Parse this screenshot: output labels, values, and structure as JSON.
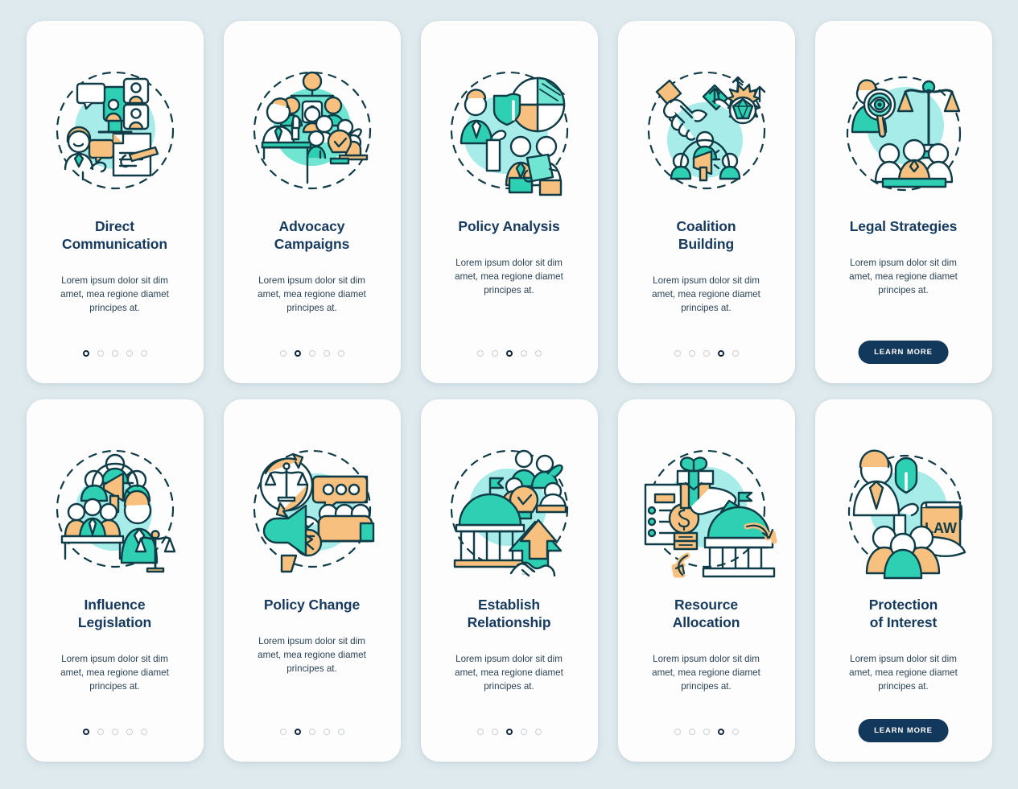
{
  "page": {
    "background_color": "#dfeaee",
    "card_background": "#fdfdfd",
    "title_color": "#163a5f",
    "body_color": "#2b4256",
    "accent_teal": "#2ecfb3",
    "accent_mint": "#a8ecea",
    "accent_orange": "#f8c07e",
    "outline_color": "#0f3c47",
    "button_color": "#12385c",
    "dot_inactive_color": "#c9ced3",
    "dot_active_color": "#10263d"
  },
  "body_text": "Lorem ipsum dolor sit dim\namet, mea regione diamet\nprincipes at.",
  "learn_more_label": "LEARN MORE",
  "dots_total": 5,
  "cards": [
    {
      "id": "direct-communication",
      "title": "Direct\nCommunication",
      "illustration": "direct-communication-illustration",
      "body": "Lorem ipsum dolor sit dim\namet, mea regione diamet\nprincipes at.",
      "footer": "dots",
      "active_dot": 1
    },
    {
      "id": "advocacy-campaigns",
      "title": "Advocacy\nCampaigns",
      "illustration": "advocacy-campaigns-illustration",
      "body": "Lorem ipsum dolor sit dim\namet, mea regione diamet\nprincipes at.",
      "footer": "dots",
      "active_dot": 2
    },
    {
      "id": "policy-analysis",
      "title": "Policy Analysis",
      "illustration": "policy-analysis-illustration",
      "body": "Lorem ipsum dolor sit dim\namet, mea regione diamet\nprincipes at.",
      "footer": "dots",
      "active_dot": 3
    },
    {
      "id": "coalition-building",
      "title": "Coalition\nBuilding",
      "illustration": "coalition-building-illustration",
      "body": "Lorem ipsum dolor sit dim\namet, mea regione diamet\nprincipes at.",
      "footer": "dots",
      "active_dot": 4
    },
    {
      "id": "legal-strategies",
      "title": "Legal Strategies",
      "illustration": "legal-strategies-illustration",
      "body": "Lorem ipsum dolor sit dim\namet, mea regione diamet\nprincipes at.",
      "footer": "button",
      "active_dot": 0
    },
    {
      "id": "influence-legislation",
      "title": "Influence\nLegislation",
      "illustration": "influence-legislation-illustration",
      "body": "Lorem ipsum dolor sit dim\namet, mea regione diamet\nprincipes at.",
      "footer": "dots",
      "active_dot": 1
    },
    {
      "id": "policy-change",
      "title": "Policy Change",
      "illustration": "policy-change-illustration",
      "body": "Lorem ipsum dolor sit dim\namet, mea regione diamet\nprincipes at.",
      "footer": "dots",
      "active_dot": 2
    },
    {
      "id": "establish-relationship",
      "title": "Establish\nRelationship",
      "illustration": "establish-relationship-illustration",
      "body": "Lorem ipsum dolor sit dim\namet, mea regione diamet\nprincipes at.",
      "footer": "dots",
      "active_dot": 3
    },
    {
      "id": "resource-allocation",
      "title": "Resource\nAllocation",
      "illustration": "resource-allocation-illustration",
      "body": "Lorem ipsum dolor sit dim\namet, mea regione diamet\nprincipes at.",
      "footer": "dots",
      "active_dot": 4
    },
    {
      "id": "protection-of-interest",
      "title": "Protection\nof Interest",
      "illustration": "protection-of-interest-illustration",
      "body": "Lorem ipsum dolor sit dim\namet, mea regione diamet\nprincipes at.",
      "footer": "button",
      "active_dot": 0
    }
  ]
}
